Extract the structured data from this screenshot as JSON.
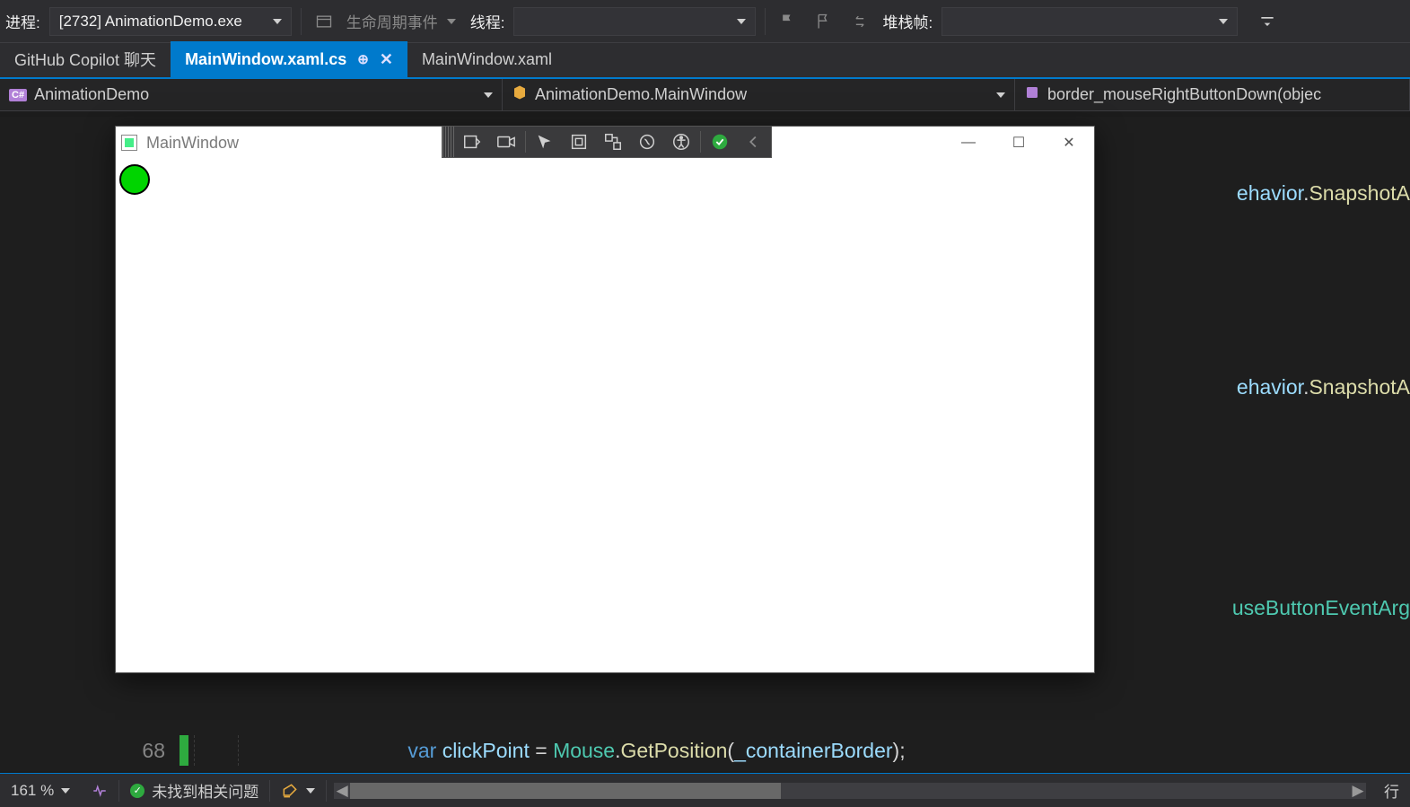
{
  "debug_bar": {
    "process_label": "进程:",
    "process_value": "[2732] AnimationDemo.exe",
    "lifecycle_label": "生命周期事件",
    "thread_label": "线程:",
    "thread_value": "",
    "stackframe_label": "堆栈帧:",
    "stackframe_value": ""
  },
  "tabs": {
    "copilot": "GitHub Copilot 聊天",
    "active": "MainWindow.xaml.cs",
    "xaml": "MainWindow.xaml"
  },
  "nav": {
    "project": "AnimationDemo",
    "class": "AnimationDemo.MainWindow",
    "method": "border_mouseRightButtonDown(objec"
  },
  "app_window": {
    "title": "MainWindow"
  },
  "code": {
    "line68_num": "68",
    "line68_kw": "var",
    "line68_var": "clickPoint",
    "line68_eq": " = ",
    "line68_cls": "Mouse",
    "line68_dot1": ".",
    "line68_fn": "GetPosition",
    "line68_paren1": "(",
    "line68_arg": "_containerBorder",
    "line68_paren2": ");",
    "frag1": "ehavior",
    "frag1b": ".",
    "frag1c": "SnapshotA",
    "frag2": "ehavior",
    "frag2b": ".",
    "frag2c": "SnapshotA",
    "frag3": "useButtonEventArg"
  },
  "status": {
    "zoom": "161 %",
    "issues": "未找到相关问题",
    "line_label": "行"
  }
}
